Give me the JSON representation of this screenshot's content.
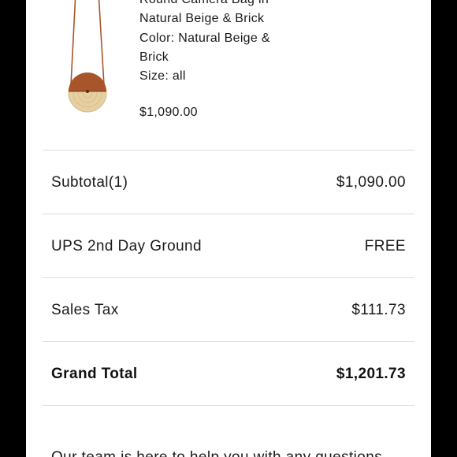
{
  "product": {
    "name_line1": "Round Camera Bag in",
    "name_line2": "Natural Beige & Brick",
    "color_line1": "Color: Natural Beige &",
    "color_line2": "Brick",
    "size": "Size: all",
    "price": "$1,090.00",
    "image_icon": "round-camera-bag-image"
  },
  "summary": {
    "rows": [
      {
        "label": "Subtotal(1)",
        "value": "$1,090.00"
      },
      {
        "label": "UPS 2nd Day Ground",
        "value": "FREE"
      },
      {
        "label": "Sales Tax",
        "value": "$111.73"
      },
      {
        "label": "Grand Total",
        "value": "$1,201.73"
      }
    ]
  },
  "footer": {
    "help_text": "Our team is here to help you with any questions"
  },
  "colors": {
    "background": "#000000",
    "panel": "#ffffff",
    "divider": "#dddddd",
    "text": "#1a1a1a",
    "bag_leather": "#a8552a",
    "bag_straw": "#e6cfa1"
  }
}
